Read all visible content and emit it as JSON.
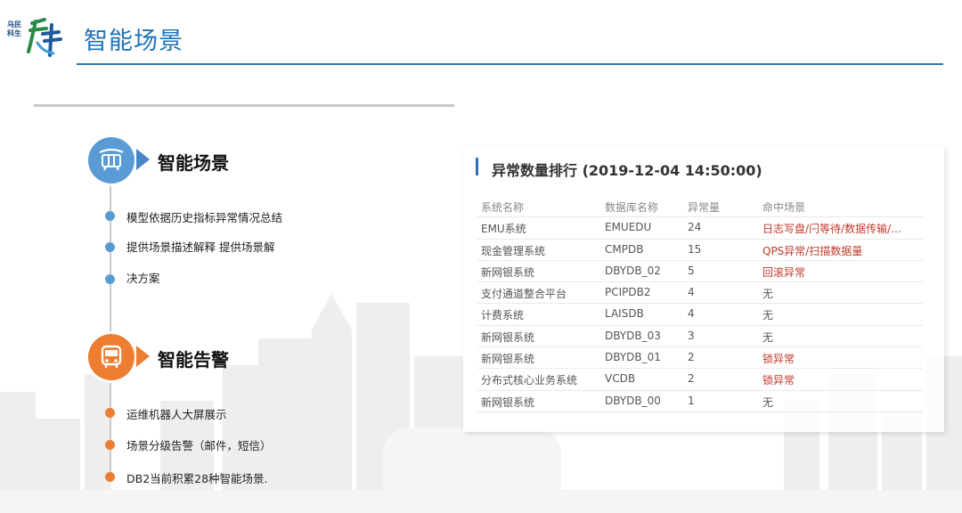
{
  "header": {
    "logo_side_text": "乌民科生",
    "title": "智能场景"
  },
  "sections": [
    {
      "title": "智能场景",
      "icon": "train-icon",
      "color": "#5b9bd5",
      "bullets": [
        "模型依据历史指标异常情况总结",
        "提供场景描述解释 提供场景解",
        "决方案"
      ]
    },
    {
      "title": "智能告警",
      "icon": "bus-icon",
      "color": "#ed7d31",
      "bullets": [
        "运维机器人大屏展示",
        "场景分级告警（邮件，短信）",
        "DB2当前积累28种智能场景."
      ]
    }
  ],
  "panel": {
    "title": "异常数量排行 (2019-12-04 14:50:00)",
    "columns": [
      "系统名称",
      "数据库名称",
      "异常量",
      "命中场景"
    ],
    "rows": [
      {
        "system": "EMU系统",
        "db": "EMUEDU",
        "count": "24",
        "scene": "日志写盘/闩等待/数据传输/...",
        "scene_color": "#c0392b"
      },
      {
        "system": "现金管理系统",
        "db": "CMPDB",
        "count": "15",
        "scene": "QPS异常/扫描数据量",
        "scene_color": "#c0392b"
      },
      {
        "system": "新网银系统",
        "db": "DBYDB_02",
        "count": "5",
        "scene": "回滚异常",
        "scene_color": "#c0392b"
      },
      {
        "system": "支付通道整合平台",
        "db": "PCIPDB2",
        "count": "4",
        "scene": "无",
        "scene_color": "#555555"
      },
      {
        "system": "计费系统",
        "db": "LAISDB",
        "count": "4",
        "scene": "无",
        "scene_color": "#555555"
      },
      {
        "system": "新网银系统",
        "db": "DBYDB_03",
        "count": "3",
        "scene": "无",
        "scene_color": "#555555"
      },
      {
        "system": "新网银系统",
        "db": "DBYDB_01",
        "count": "2",
        "scene": "锁异常",
        "scene_color": "#c0392b"
      },
      {
        "system": "分布式核心业务系统",
        "db": "VCDB",
        "count": "2",
        "scene": "锁异常",
        "scene_color": "#c0392b"
      },
      {
        "system": "新网银系统",
        "db": "DBYDB_00",
        "count": "1",
        "scene": "无",
        "scene_color": "#555555"
      }
    ]
  }
}
